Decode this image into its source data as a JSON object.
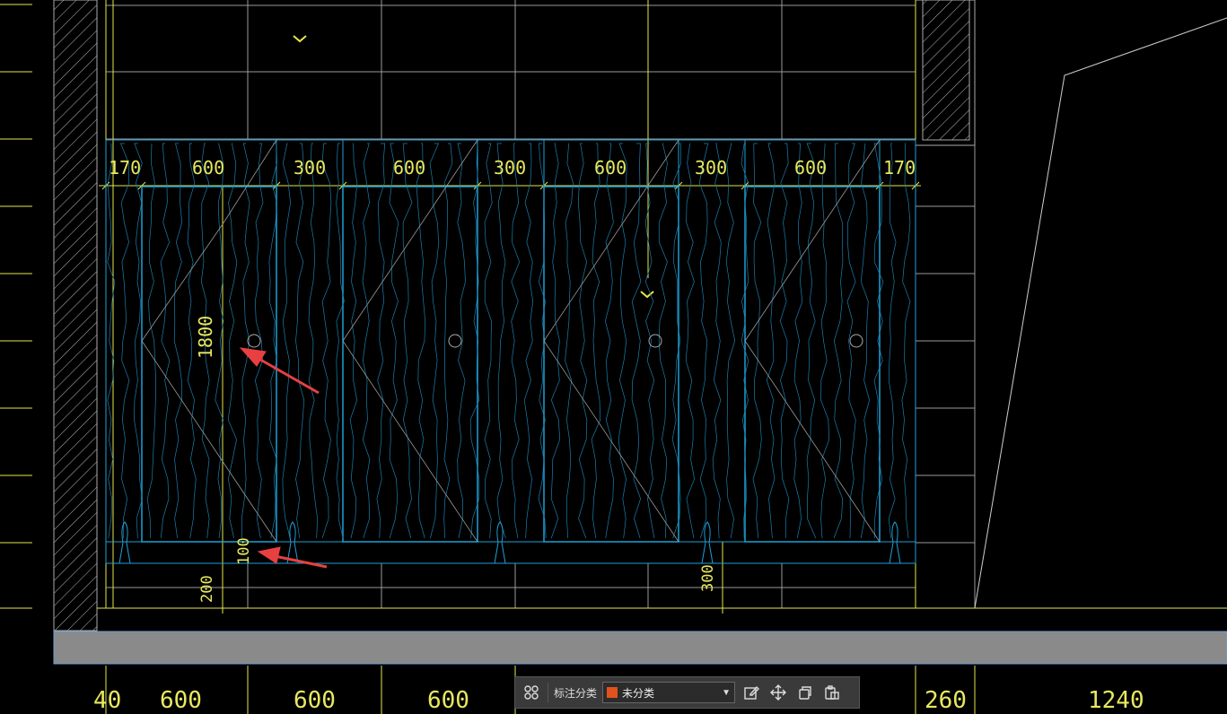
{
  "drawing": {
    "top_dims": [
      "170",
      "600",
      "300",
      "600",
      "300",
      "600",
      "300",
      "600",
      "170"
    ],
    "height_dim": "1800",
    "gap_dim": "100",
    "base_dim": "200",
    "leg_dim": "300",
    "bottom_dims": [
      "40",
      "600",
      "600",
      "600",
      "260",
      "1240"
    ],
    "colors": {
      "line_yellow": "#e6e64a",
      "line_cyan": "#1ea0d6",
      "line_grey": "#9a9a9a",
      "arrow_red": "#e84040",
      "band_grey": "#8a8a8a"
    }
  },
  "toolbar": {
    "label": "标注分类",
    "category_value": "未分类",
    "category_color": "#e0531c",
    "icons": [
      "grid-icon",
      "edit-icon",
      "move-icon",
      "copy-icon",
      "paste-icon"
    ]
  }
}
